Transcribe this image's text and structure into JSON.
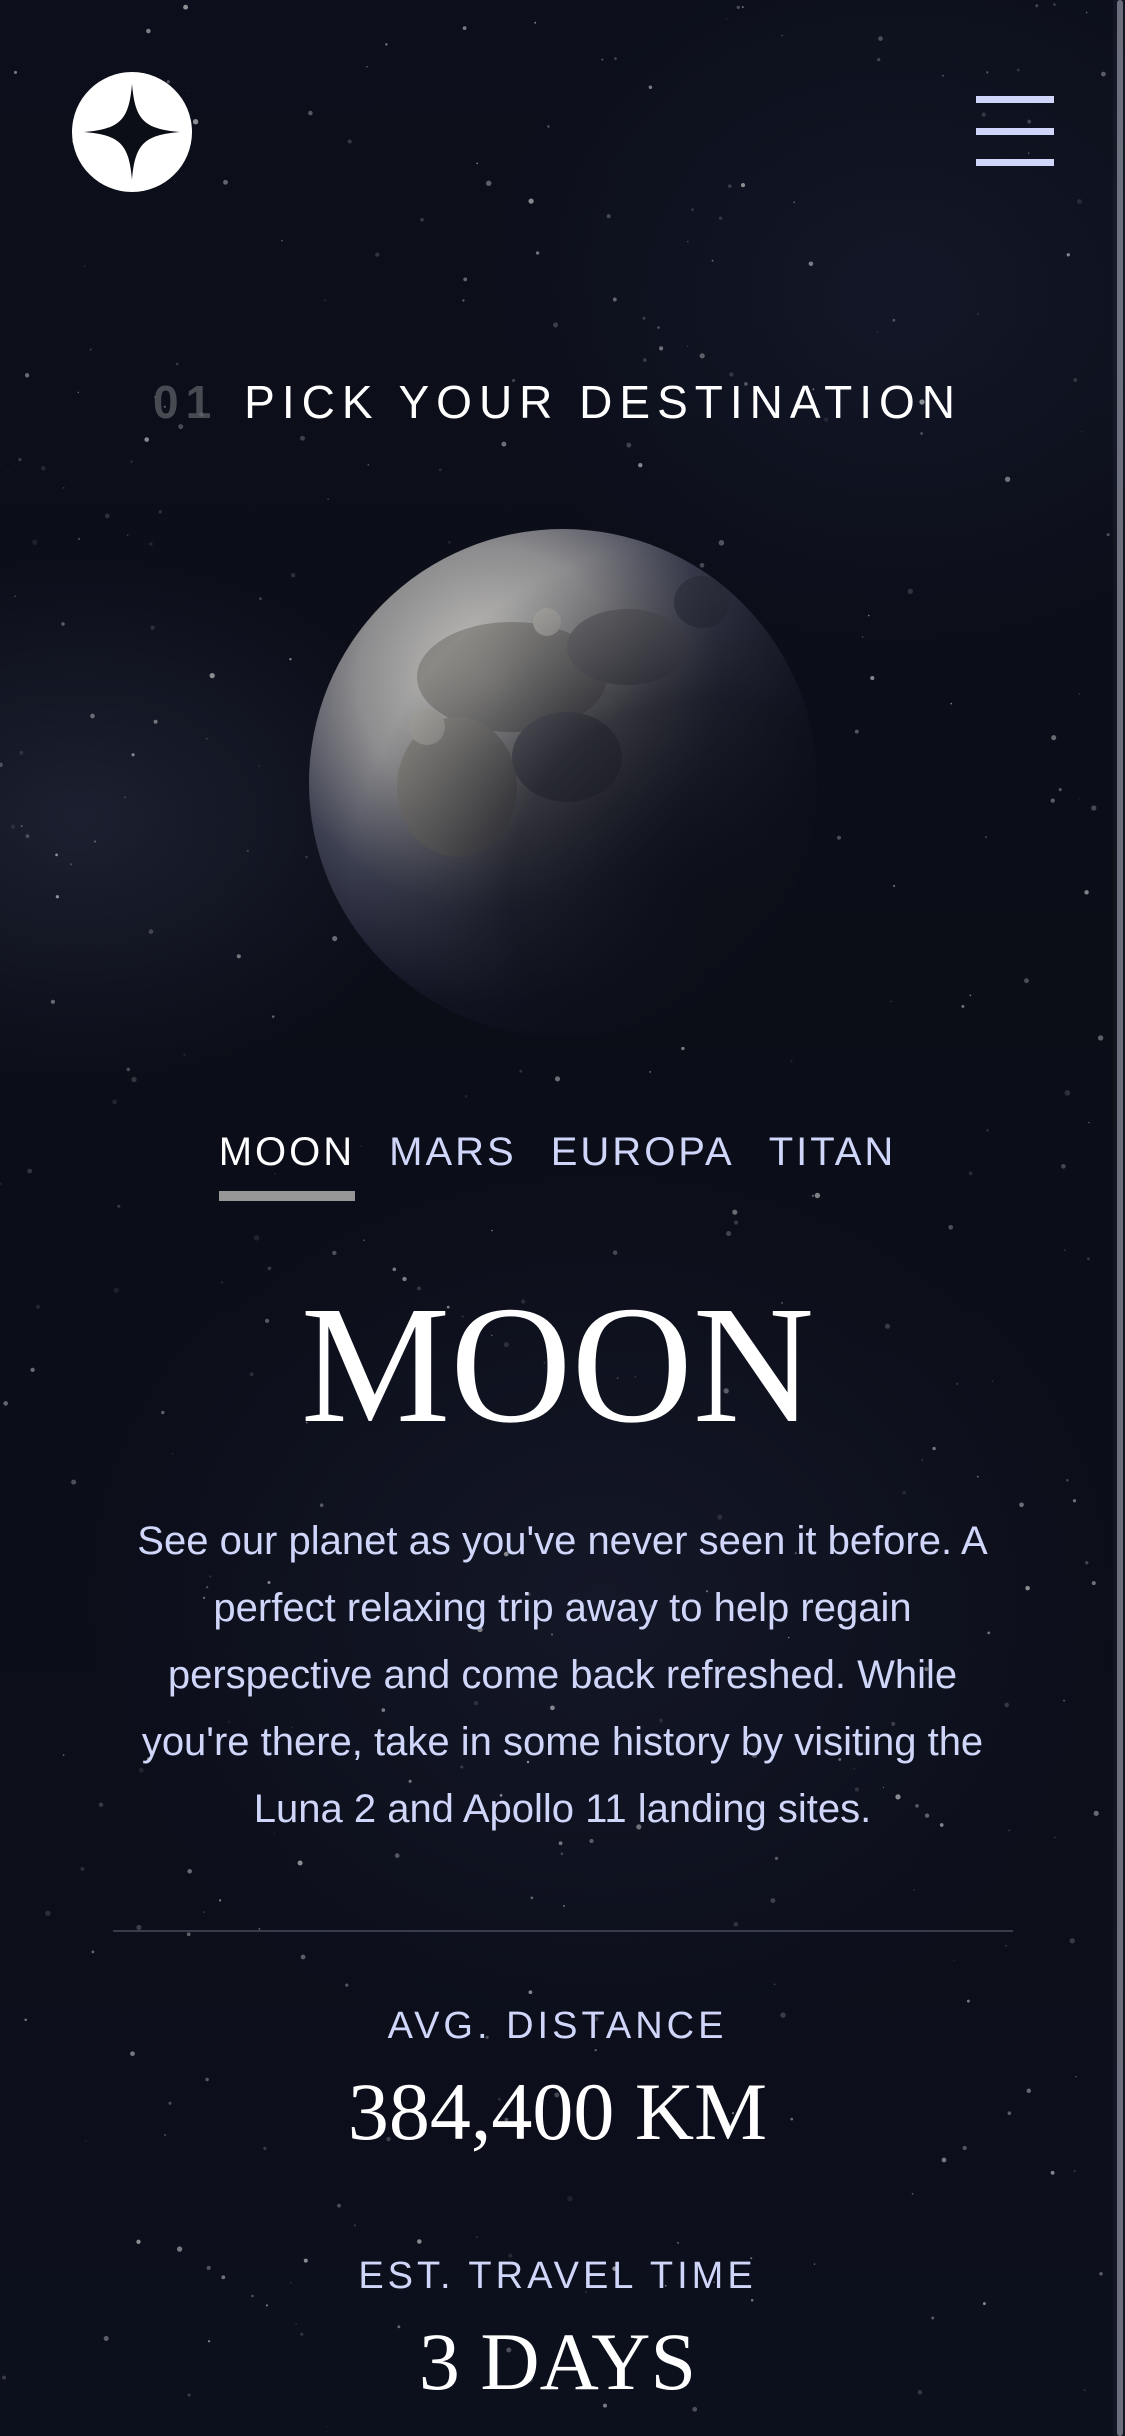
{
  "header": {
    "logo_icon": "star-logo-icon",
    "menu_icon": "hamburger-menu-icon"
  },
  "page_heading": {
    "number": "01",
    "text": "PICK YOUR DESTINATION"
  },
  "tabs": [
    {
      "label": "MOON",
      "active": true
    },
    {
      "label": "MARS",
      "active": false
    },
    {
      "label": "EUROPA",
      "active": false
    },
    {
      "label": "TITAN",
      "active": false
    }
  ],
  "destination": {
    "name": "MOON",
    "description": "See our planet as you've never seen it before. A perfect relaxing trip away to help regain perspective and come back refreshed. While you're there, take in some history by visiting the Luna 2 and Apollo 11 landing sites."
  },
  "stats": {
    "distance_label": "AVG. DISTANCE",
    "distance_value": "384,400 KM",
    "travel_label": "EST. TRAVEL TIME",
    "travel_value": "3 DAYS"
  },
  "colors": {
    "background": "#0b0d17",
    "text_light": "#d0d6f9",
    "white": "#ffffff",
    "tab_indicator": "#979797"
  }
}
